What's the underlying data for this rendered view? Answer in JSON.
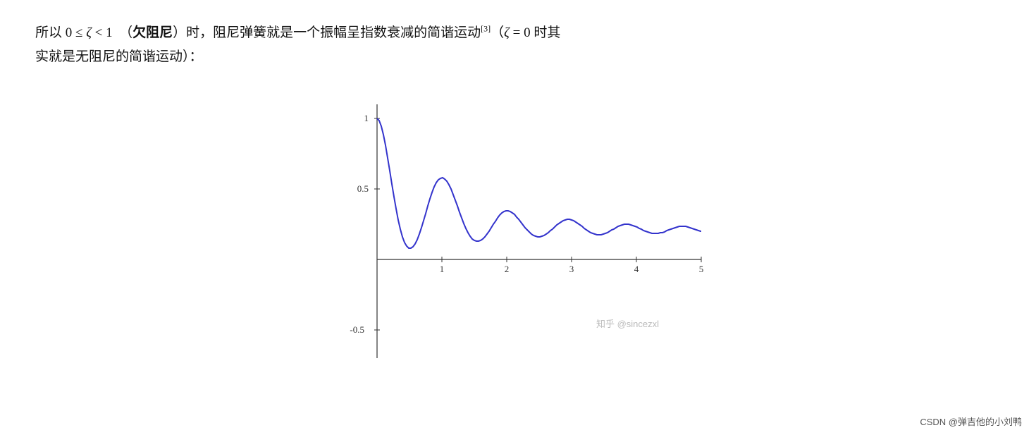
{
  "text": {
    "line1": "所以 0 ≤ ζ < 1  （欠阻尼）时，阻尼弹簧就是一个振幅呈指数衰减的简谐运动",
    "ref": "[3]",
    "line1_end": " （ζ = 0 时其",
    "line2": "实就是无阻尼的简谐运动）：",
    "bold": "欠阻尼",
    "watermark": "知乎 @sincezxl",
    "footer": "CSDN @弹吉他的小刘鸭"
  },
  "chart": {
    "xMin": 0,
    "xMax": 5,
    "yMin": -0.7,
    "yMax": 1.1,
    "xLabels": [
      "1",
      "2",
      "3",
      "4",
      "5"
    ],
    "yLabels": [
      "-0.5",
      "0.5",
      "1"
    ],
    "color": "#3333cc",
    "zeta": 0.2
  }
}
